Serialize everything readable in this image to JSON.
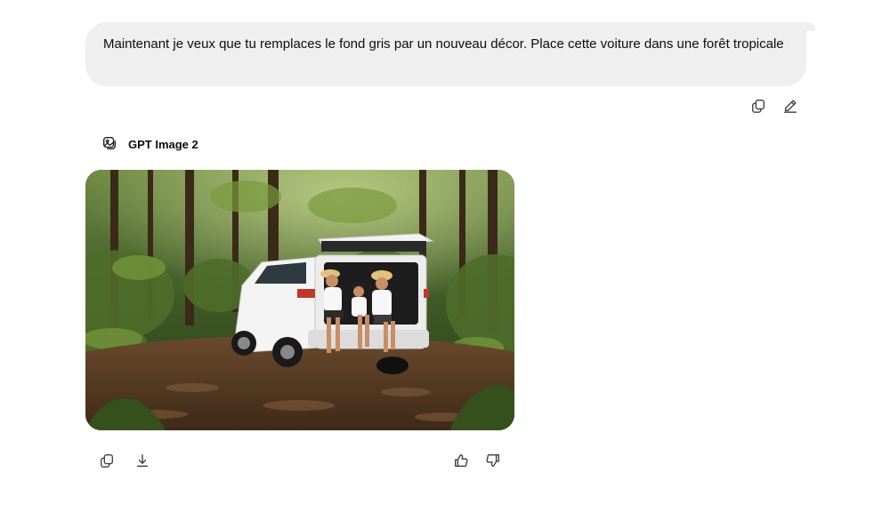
{
  "user_message": {
    "text": "Maintenant je veux que tu remplaces le fond gris par un nouveau décor. Place cette voiture dans une forêt tropicale"
  },
  "user_actions": [
    {
      "name": "copy-icon"
    },
    {
      "name": "edit-icon"
    }
  ],
  "assistant": {
    "model_icon": "image-icon",
    "model_name": "GPT Image 2",
    "image": {
      "depicts": "white SUV with open tailgate on a leaf-covered forest trail, family of three sitting in the trunk"
    }
  },
  "assistant_actions": [
    {
      "name": "copy-icon"
    },
    {
      "name": "download-icon"
    },
    {
      "name": "thumbs-up-icon"
    },
    {
      "name": "thumbs-down-icon"
    }
  ],
  "colors": {
    "bubble_bg": "#efefef",
    "text": "#0d0d0d",
    "icon": "#3d3d3d"
  }
}
